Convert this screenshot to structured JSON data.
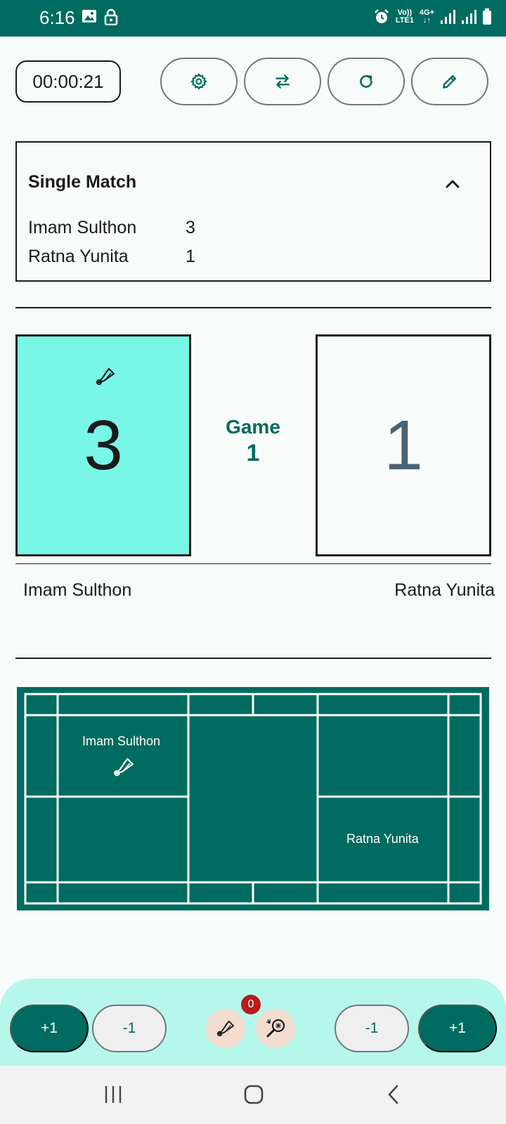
{
  "status_bar": {
    "time": "6:16",
    "left_icons": [
      "image-icon",
      "lock-icon"
    ],
    "right_icons": [
      "alarm-icon",
      "volte-icon",
      "4g-icon",
      "signal-icon",
      "signal-icon",
      "battery-icon"
    ],
    "volte_label_1": "Vo))",
    "volte_label_2": "LTE1",
    "network_label": "4G+"
  },
  "toolbar": {
    "timer": "00:00:21",
    "buttons": [
      "gear-icon",
      "swap-icon",
      "refresh-icon",
      "pencil-icon"
    ]
  },
  "match_card": {
    "title": "Single Match",
    "players": [
      {
        "name": "Imam Sulthon",
        "score": "3"
      },
      {
        "name": "Ratna Yunita",
        "score": "1"
      }
    ]
  },
  "scoreboard": {
    "left_score": "3",
    "right_score": "1",
    "game_label": "Game",
    "game_number": "1",
    "left_player": "Imam Sulthon",
    "right_player": "Ratna Yunita",
    "serving": "left"
  },
  "court": {
    "left_player": "Imam Sulthon",
    "right_player": "Ratna Yunita",
    "color": "#006b60"
  },
  "bottom_bar": {
    "left_plus": "+1",
    "left_minus": "-1",
    "right_minus": "-1",
    "right_plus": "+1",
    "badge_count": "0"
  },
  "colors": {
    "primary": "#006b60",
    "serving_box": "#78f7e6",
    "bottom_bar": "#b6f7ec",
    "badge": "#ba1a1a"
  }
}
